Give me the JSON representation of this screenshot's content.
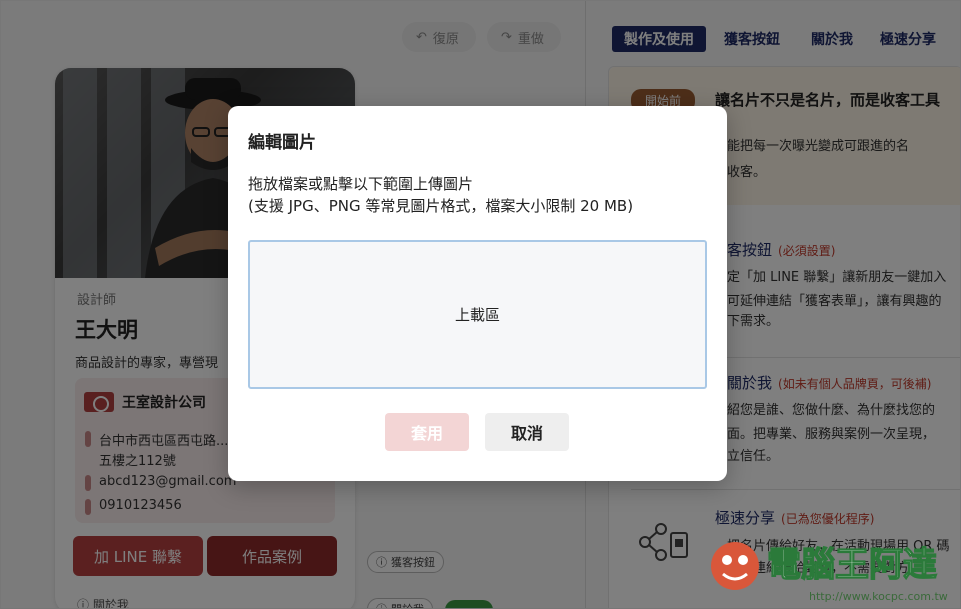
{
  "toolbar": {
    "undo_label": "復原",
    "redo_label": "重做"
  },
  "card": {
    "role": "設計師",
    "name": "王大明",
    "tagline": "商品設計的專家，專營現",
    "company": "王室設計公司",
    "address": "台中市西屯區西屯路...",
    "address2": "五樓之112號",
    "email": "abcd123@gmail.com",
    "phone": "0910123456",
    "btn_line": "加 LINE 聯繫",
    "btn_works": "作品案例",
    "bottom_label": "關於我",
    "chip_lead": "獲客按鈕",
    "chip_about": "關於我"
  },
  "tabs": [
    {
      "label": "製作及使用"
    },
    {
      "label": "獲客按鈕"
    },
    {
      "label": "關於我"
    },
    {
      "label": "極速分享"
    }
  ],
  "guide": {
    "start_badge": "開始前",
    "start_title": "讓名片不只是名片，而是收客工具",
    "start_l1": "能把每一次曝光變成可跟進的名",
    "start_l2": "收客。",
    "lead_title": "客按鈕",
    "lead_note": "(必須設置)",
    "lead_l1": "定「加 LINE 聯繫」讓新朋友一鍵加入",
    "lead_l2": "可延伸連結「獲客表單」，讓有興趣的",
    "lead_l3": "下需求。",
    "about_title": "關於我",
    "about_note": "(如未有個人品牌頁，可後補)",
    "about_l1": "紹您是誰、您做什麼、為什麼找您的",
    "about_l2": "面。把專業、服務與案例一次呈現，",
    "about_l3": "立信任。",
    "share_title": "極速分享",
    "share_note": "(已為您優化程序)",
    "share_l1": "把名片傳給好友，在活動現場用 QR 碼",
    "share_l2": "名片連結傳給對方，不需要對方"
  },
  "modal": {
    "title": "編輯圖片",
    "desc1": "拖放檔案或點擊以下範圍上傳圖片",
    "desc2": "(支援 JPG、PNG 等常見圖片格式，檔案大小限制 20 MB)",
    "dropzone": "上載區",
    "apply": "套用",
    "cancel": "取消"
  },
  "watermark": {
    "text": "電腦王阿達",
    "url": "http://www.kocpc.com.tw"
  },
  "colors": {
    "brand_navy": "#1e2b66",
    "brand_red": "#b64141",
    "overlay": "rgba(0,0,0,0.5)"
  }
}
